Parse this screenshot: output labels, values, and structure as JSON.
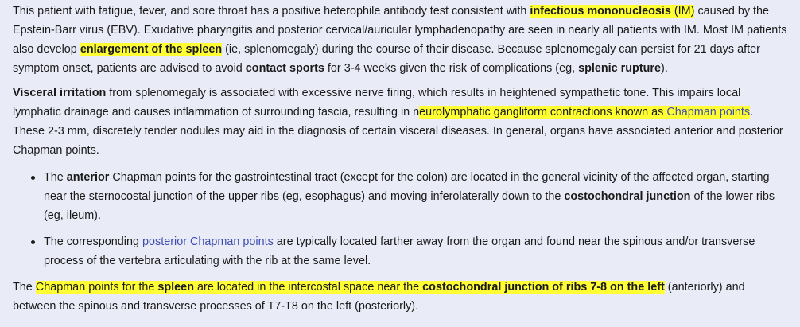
{
  "p1": {
    "t1": "This patient with fatigue, fever, and sore throat has a positive heterophile antibody test consistent with ",
    "h1": "infectious mononucleosis",
    "h1b": " (IM)",
    "t2": " caused by the Epstein-Barr virus (EBV).  Exudative pharyngitis and posterior cervical/auricular lymphadenopathy are seen in nearly all patients with IM.  Most IM patients also develop ",
    "h2": "enlargement of the spleen",
    "t3": " (ie, splenomegaly) during the course of their disease.  Because splenomegaly can persist for 21 days after symptom onset, patients are advised to avoid ",
    "b1": "contact sports",
    "t4": " for 3-4 weeks given the risk of complications (eg, ",
    "b2": "splenic rupture",
    "t5": ")."
  },
  "p2": {
    "b1": "Visceral irritation",
    "t1": " from splenomegaly is associated with excessive nerve firing, which results in heightened sympathetic tone.  This impairs local lymphatic drainage and causes inflammation of surrounding fascia, resulting in n",
    "h1": "eurolymphatic gangliform contractions known as ",
    "h1link": "Chapman points",
    "t2": ".  These 2-3 mm, discretely tender nodules may aid in the diagnosis of certain visceral diseases.  In general, organs have associated anterior and posterior Chapman points."
  },
  "list": {
    "item1": {
      "t1": "The ",
      "b1": "anterior",
      "t2": " Chapman points for the gastrointestinal tract (except for the colon) are located in the general vicinity of the affected organ, starting near the sternocostal junction of the upper ribs (eg, esophagus) and moving inferolaterally down to the ",
      "b2": "costochondral junction",
      "t3": " of the lower ribs (eg, ileum)."
    },
    "item2": {
      "t1": "The corresponding ",
      "link": "posterior Chapman points",
      "t2": " are typically located farther away from the organ and found near the spinous and/or transverse process of the vertebra articulating with the rib at the same level."
    }
  },
  "p3": {
    "t1": "The ",
    "h1": "Chapman points for the ",
    "h1b": "spleen",
    "h2": " are located in the intercostal space near the ",
    "h2b": "costochondral junction of ribs 7-8 on the left",
    "t2": " (anteriorly) and between the spinous and transverse processes of T7-T8 on the left (posteriorly)."
  },
  "colors": {
    "highlight": "#ffff33",
    "link": "#3f4fb0",
    "background": "#e9ebf7"
  }
}
